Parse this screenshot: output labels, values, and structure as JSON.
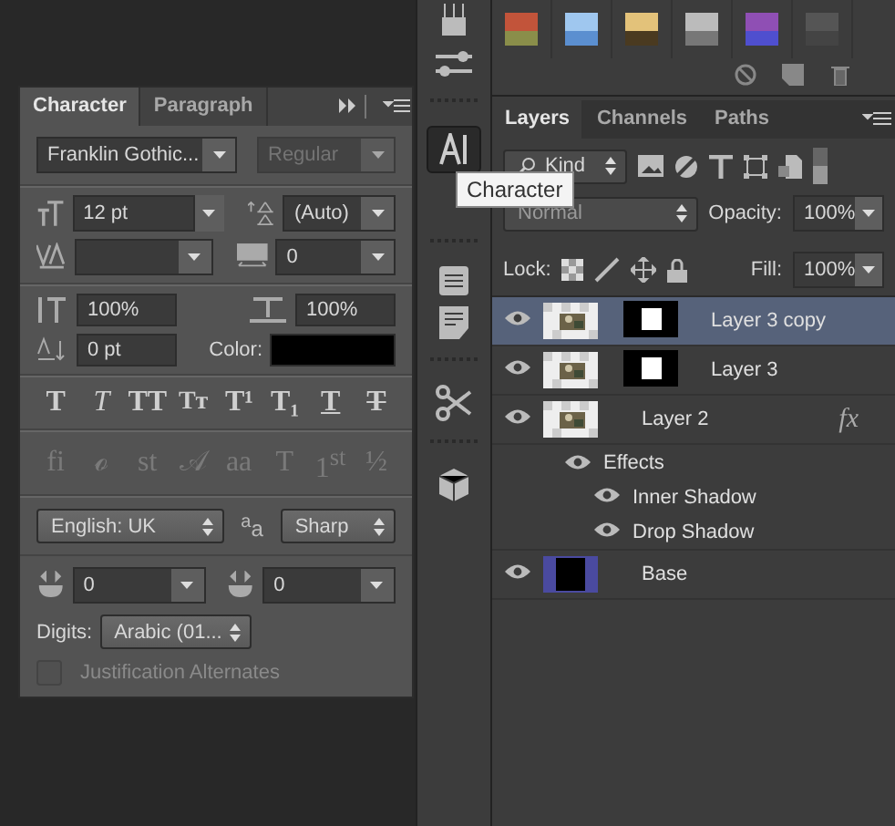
{
  "dock": {
    "character_button": {
      "selected": true
    }
  },
  "tooltip": "Character",
  "character_panel": {
    "tabs": [
      {
        "label": "Character",
        "selected": true
      },
      {
        "label": "Paragraph",
        "selected": false
      }
    ],
    "font_family": "Franklin Gothic...",
    "font_style": {
      "value": "Regular",
      "disabled": true
    },
    "font_size": "12 pt",
    "leading": "(Auto)",
    "tracking": "0",
    "vertical_scale": "100%",
    "horizontal_scale": "100%",
    "baseline_shift": "0 pt",
    "color_label": "Color:",
    "color": "#000000",
    "style_buttons": [
      {
        "kind": "bold",
        "label": "T"
      },
      {
        "kind": "italic",
        "label": "T"
      },
      {
        "kind": "plain",
        "label": "TT"
      },
      {
        "kind": "smallcaps",
        "label": "Tт"
      },
      {
        "kind": "super",
        "label": "T¹"
      },
      {
        "kind": "sub",
        "label": "T₁"
      },
      {
        "kind": "underline",
        "label": "T"
      },
      {
        "kind": "strike",
        "label": "T"
      }
    ],
    "opentype_buttons": [
      {
        "label": "fi",
        "disabled": true
      },
      {
        "label": "ℴ",
        "disabled": true
      },
      {
        "label": "st",
        "disabled": true
      },
      {
        "label": "𝒜",
        "disabled": true
      },
      {
        "label": "aa",
        "disabled": true
      },
      {
        "label": "T",
        "disabled": true
      },
      {
        "label": "1$^{st}$",
        "disabled": true
      },
      {
        "label": "½",
        "disabled": true
      }
    ],
    "language": "English: UK",
    "antialias_icon": "$^{a}$a",
    "antialias": "Sharp",
    "arabic_fields": [
      "0",
      "0"
    ],
    "digits_label": "Digits:",
    "digits": "Arabic (01...",
    "justification": {
      "label": "Justification Alternates",
      "checked": false,
      "disabled": true
    }
  },
  "layers_panel": {
    "tabs": [
      {
        "label": "Layers",
        "selected": true
      },
      {
        "label": "Channels",
        "selected": false
      },
      {
        "label": "Paths",
        "selected": false
      }
    ],
    "filter": "Kind",
    "blend_mode": "Normal",
    "opacity_label": "Opacity:",
    "opacity": "100%",
    "lock_label": "Lock:",
    "fill_label": "Fill:",
    "fill": "100%",
    "layers": [
      {
        "name": "Layer 3 copy",
        "kind": "masked",
        "visible": true,
        "selected": true
      },
      {
        "name": "Layer 3",
        "kind": "masked",
        "visible": true,
        "selected": false
      },
      {
        "name": "Layer 2",
        "kind": "effects",
        "visible": true,
        "selected": false,
        "fx": "fx",
        "effects_label": "Effects",
        "effects": [
          {
            "name": "Inner Shadow",
            "visible": true
          },
          {
            "name": "Drop Shadow",
            "visible": true
          }
        ]
      },
      {
        "name": "Base",
        "kind": "solid",
        "visible": true,
        "selected": false
      }
    ]
  }
}
